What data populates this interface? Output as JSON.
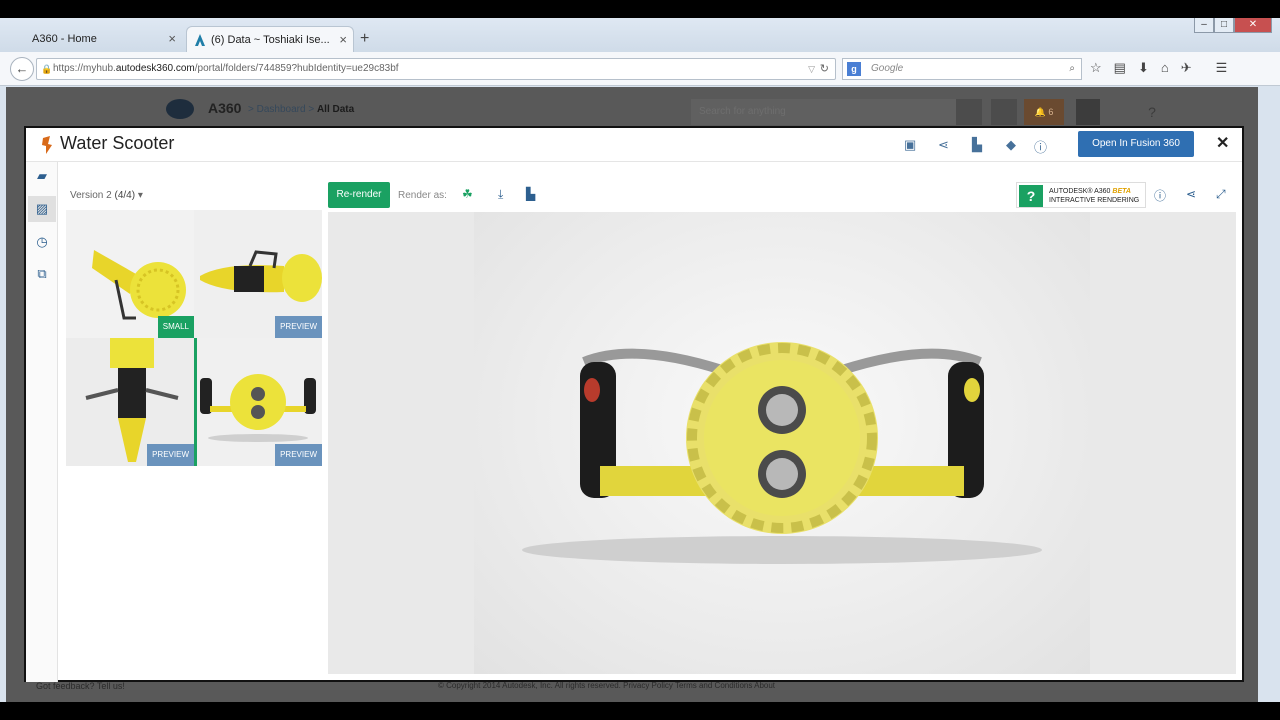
{
  "browser": {
    "tabs": [
      {
        "label": "A360 - Home",
        "active": false
      },
      {
        "label": "(6) Data ~ Toshiaki Ise...",
        "active": true
      }
    ],
    "new_tab": "+",
    "url_prefix": "https://myhub.",
    "url_domain": "autodesk360.com",
    "url_suffix": "/portal/folders/744859?hubIdentity=ue29c83bf",
    "search_placeholder": "Google"
  },
  "a360": {
    "title": "A360",
    "breadcrumb_1": "Dashboard",
    "breadcrumb_sep": ">",
    "breadcrumb_2": "All Data",
    "search_placeholder": "Search for anything",
    "notifications": "6",
    "help": "?",
    "feedback": "Got feedback? Tell us!",
    "footer": "© Copyright 2014 Autodesk, Inc. All rights reserved.   Privacy Policy   Terms and Conditions   About"
  },
  "modal": {
    "title": "Water Scooter",
    "open_button": "Open In Fusion 360",
    "close": "✕",
    "version_label": "Version 2",
    "version_count": "(4/4)",
    "thumbnails": [
      {
        "badge": "SMALL"
      },
      {
        "badge": "PREVIEW"
      },
      {
        "badge": "PREVIEW"
      },
      {
        "badge": "PREVIEW"
      }
    ],
    "rerender_button": "Re-render",
    "render_as": "Render as:",
    "ir_brand": "AUTODESK® A360",
    "ir_beta": "BETA",
    "ir_product": "INTERACTIVE RENDERING"
  },
  "colors": {
    "accent_green": "#1aa162",
    "accent_blue": "#2f6fb2",
    "icon_blue": "#2d5f8f",
    "preview_badge": "#6a93bd"
  }
}
